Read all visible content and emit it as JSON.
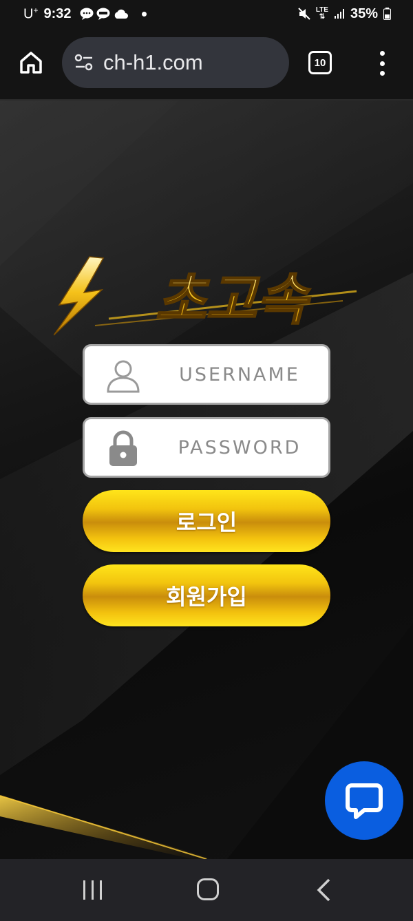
{
  "status_bar": {
    "carrier": "U",
    "carrier_sup": "+",
    "time": "9:32",
    "network": "LTE",
    "battery": "35%"
  },
  "browser": {
    "url": "ch-h1.com",
    "tab_count": "10"
  },
  "login": {
    "logo_text": "초고속",
    "username_placeholder": "USERNAME",
    "password_placeholder": "PASSWORD",
    "login_label": "로그인",
    "signup_label": "회원가입"
  },
  "colors": {
    "gold": "#f2c40e",
    "chat_blue": "#0a5ee0"
  },
  "icons": [
    "home-icon",
    "site-settings-icon",
    "tabs-icon",
    "more-menu-icon",
    "user-icon",
    "lock-icon",
    "chat-icon"
  ]
}
